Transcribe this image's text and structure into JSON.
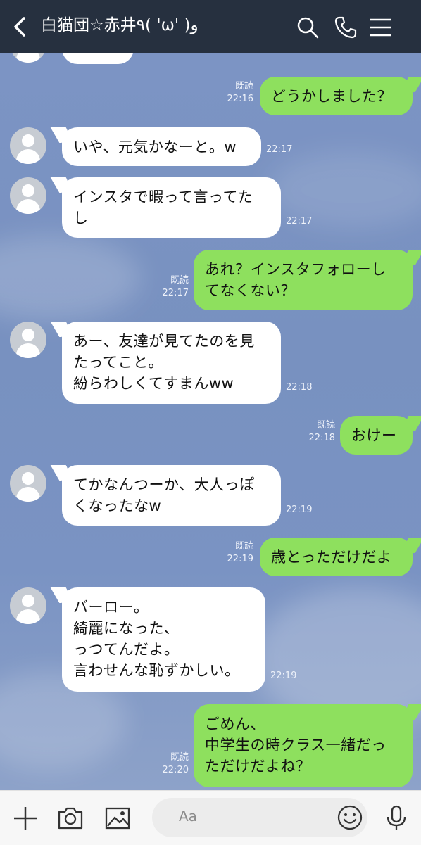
{
  "header": {
    "title": "白猫団☆赤井٩( 'ω' )و",
    "back_icon": "chevron-left-icon",
    "actions": [
      "search-icon",
      "phone-icon",
      "menu-icon"
    ]
  },
  "messages": [
    {
      "side": "in",
      "lines": [
        ""
      ],
      "time": ""
    },
    {
      "side": "out",
      "lines": [
        "どうかしました？"
      ],
      "read": "既読",
      "time": "22:16"
    },
    {
      "side": "in",
      "lines": [
        "いや、元気かなーと。w"
      ],
      "time": "22:17"
    },
    {
      "side": "in",
      "lines": [
        "インスタで暇って言ってた",
        "し"
      ],
      "time": "22:17"
    },
    {
      "side": "out",
      "lines": [
        "あれ？インスタフォローし",
        "てなくない？"
      ],
      "read": "既読",
      "time": "22:17"
    },
    {
      "side": "in",
      "lines": [
        "あー、友達が見てたのを見",
        "たってこと。",
        "紛らわしくてすまんww"
      ],
      "time": "22:18"
    },
    {
      "side": "out",
      "lines": [
        "おけー"
      ],
      "read": "既読",
      "time": "22:18"
    },
    {
      "side": "in",
      "lines": [
        "てかなんつーか、大人っぽ",
        "くなったなw"
      ],
      "time": "22:19"
    },
    {
      "side": "out",
      "lines": [
        "歳とっただけだよ"
      ],
      "read": "既読",
      "time": "22:19"
    },
    {
      "side": "in",
      "lines": [
        "バーロー。",
        "綺麗になった、",
        "っつてんだよ。",
        "言わせんな恥ずかしい。"
      ],
      "time": "22:19"
    },
    {
      "side": "out",
      "lines": [
        "ごめん、",
        "中学生の時クラス一緒だっ",
        "ただけだよね？"
      ],
      "read": "既読",
      "time": "22:20"
    }
  ],
  "input": {
    "placeholder": "Aa",
    "icons": [
      "plus-icon",
      "camera-icon",
      "image-icon",
      "emoji-icon",
      "microphone-icon"
    ]
  },
  "colors": {
    "header_bg": "#26303f",
    "chat_bg": "#7b93c2",
    "incoming_bubble": "#ffffff",
    "outgoing_bubble": "#8ee05e"
  }
}
